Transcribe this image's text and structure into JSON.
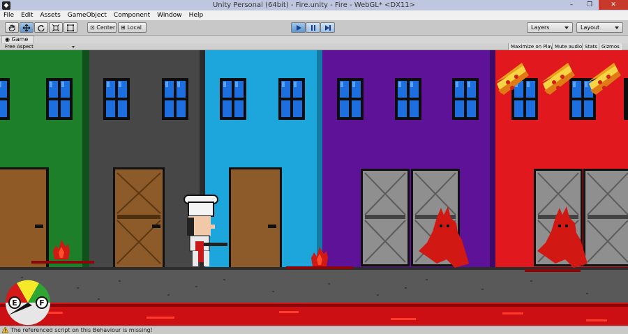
{
  "window": {
    "title": "Unity Personal (64bit) - Fire.unity - Fire - WebGL* <DX11>",
    "app_icon": "unity-icon",
    "controls": {
      "minimize": "–",
      "restore": "❐",
      "close": "✕"
    }
  },
  "menu": [
    "File",
    "Edit",
    "Assets",
    "GameObject",
    "Component",
    "Window",
    "Help"
  ],
  "toolbar": {
    "tools": [
      "hand-tool-icon",
      "move-tool-icon",
      "rotate-tool-icon",
      "scale-tool-icon",
      "rect-tool-icon"
    ],
    "pivot_label": "Center",
    "space_label": "Local",
    "play_controls": [
      "play-icon",
      "pause-icon",
      "step-icon"
    ],
    "layers_label": "Layers",
    "layout_label": "Layout"
  },
  "game_view": {
    "tab_label": "Game",
    "aspect_label": "Free Aspect",
    "toggles": [
      "Maximize on Play",
      "Mute audio",
      "Stats",
      "Gizmos"
    ]
  },
  "hud": {
    "gauge_left_label": "E",
    "gauge_right_label": "F",
    "pizza_lives": 3
  },
  "status": {
    "message": "The referenced script on this Behaviour is missing!"
  },
  "colors": {
    "house_green": "#1d7f2a",
    "house_gray": "#474747",
    "house_cyan": "#1da6dc",
    "house_purple": "#5e1298",
    "house_red": "#e1191e",
    "street": "#595959",
    "lava": "#cc0f12",
    "play_active": "#5f95d0"
  }
}
